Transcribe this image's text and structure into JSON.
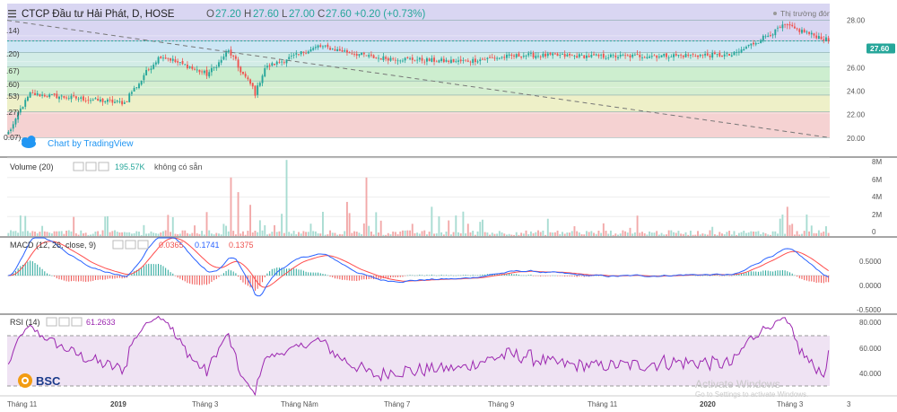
{
  "header": {
    "symbol_title": "CTCP Đầu tư Hải Phát, D, HOSE",
    "open_label": "O",
    "open": "27.20",
    "high_label": "H",
    "high": "27.60",
    "low_label": "L",
    "low": "27.00",
    "close_label": "C",
    "close": "27.60",
    "change": "+0.20 (+0.73%)",
    "market_status": "Thị trường đóng cửa"
  },
  "attribution": "Chart by TradingView",
  "price_badge": "27.60",
  "fib_labels": [
    ".14)",
    ".20)",
    ".67)",
    ".60)",
    ".53)",
    ".27)",
    "0.07)"
  ],
  "price_axis_ticks": [
    "28.00",
    "26.00",
    "24.00",
    "22.00",
    "20.00"
  ],
  "volume_panel": {
    "title": "Volume (20)",
    "value": "195.57K",
    "extra": "không có sẵn",
    "axis_ticks": [
      "8M",
      "6M",
      "4M",
      "2M",
      "0"
    ]
  },
  "macd_panel": {
    "title": "MACD (12, 26, close, 9)",
    "hist": "0.0365",
    "macd": "0.1741",
    "signal": "0.1375",
    "axis_ticks": [
      "0.5000",
      "0.0000",
      "-0.5000"
    ]
  },
  "rsi_panel": {
    "title": "RSI (14)",
    "value": "61.2633",
    "axis_ticks": [
      "80.000",
      "60.000",
      "40.000"
    ]
  },
  "time_axis": [
    "Tháng 11",
    "2019",
    "Tháng 3",
    "Tháng Năm",
    "Tháng 7",
    "Tháng 9",
    "Tháng 11",
    "2020",
    "Tháng 3",
    "3"
  ],
  "logo_text": "BSC",
  "watermark": {
    "line1": "Activate Windows",
    "line2": "Go to Settings to activate Windows."
  },
  "colors": {
    "up": "#26a69a",
    "down": "#ef5350",
    "macd_line": "#2962ff",
    "signal_line": "#ff4d4d",
    "rsi_line": "#9c27b0"
  },
  "chart_data": [
    {
      "type": "candlestick",
      "title": "CTCP Đầu tư Hải Phát, D, HOSE",
      "ylim": [
        19.5,
        30.5
      ],
      "last_close": 27.6,
      "close_keyframes": [
        {
          "x": "Tháng 11",
          "y": 20.5
        },
        {
          "x": "Tháng 11",
          "y": 23.5
        },
        {
          "x": "Tháng 12",
          "y": 23.2
        },
        {
          "x": "Tháng 12",
          "y": 22.8
        },
        {
          "x": "2019",
          "y": 26.5
        },
        {
          "x": "2019",
          "y": 25.0
        },
        {
          "x": "Tháng 2",
          "y": 26.8
        },
        {
          "x": "Tháng 3",
          "y": 23.5
        },
        {
          "x": "Tháng 4",
          "y": 25.5
        },
        {
          "x": "Tháng Năm",
          "y": 27.2
        },
        {
          "x": "Tháng 6",
          "y": 26.3
        },
        {
          "x": "Tháng 7",
          "y": 26.0
        },
        {
          "x": "Tháng 8",
          "y": 26.5
        },
        {
          "x": "Tháng 9",
          "y": 26.4
        },
        {
          "x": "Tháng 11",
          "y": 26.5
        },
        {
          "x": "2020",
          "y": 26.5
        },
        {
          "x": "Tháng 3",
          "y": 28.8
        },
        {
          "x": "Tháng 3",
          "y": 27.6
        }
      ],
      "fib_levels": [
        29.2,
        27.6,
        26.7,
        25.6,
        24.5,
        23.4,
        22.1,
        20.1
      ],
      "trendline": {
        "from": 29.2,
        "to": 20.1
      }
    },
    {
      "type": "bar",
      "title": "Volume (20)",
      "ylim": [
        0,
        8000000
      ],
      "last_value": 195570,
      "spikes": [
        {
          "x": "2019",
          "y": 2000000
        },
        {
          "x": "Tháng 2",
          "y": 6000000
        },
        {
          "x": "Tháng 4",
          "y": 7800000
        },
        {
          "x": "Tháng Năm",
          "y": 6000000
        },
        {
          "x": "Tháng 6",
          "y": 3000000
        },
        {
          "x": "Tháng 3",
          "y": 3000000
        }
      ]
    },
    {
      "type": "line",
      "title": "MACD (12, 26, close, 9)",
      "ylim": [
        -0.75,
        0.75
      ],
      "series": [
        {
          "name": "MACD",
          "last": 0.1741
        },
        {
          "name": "Signal",
          "last": 0.1375
        },
        {
          "name": "Histogram",
          "last": 0.0365
        }
      ]
    },
    {
      "type": "line",
      "title": "RSI (14)",
      "ylim": [
        25,
        90
      ],
      "bands": [
        30,
        70
      ],
      "last": 61.2633
    }
  ]
}
